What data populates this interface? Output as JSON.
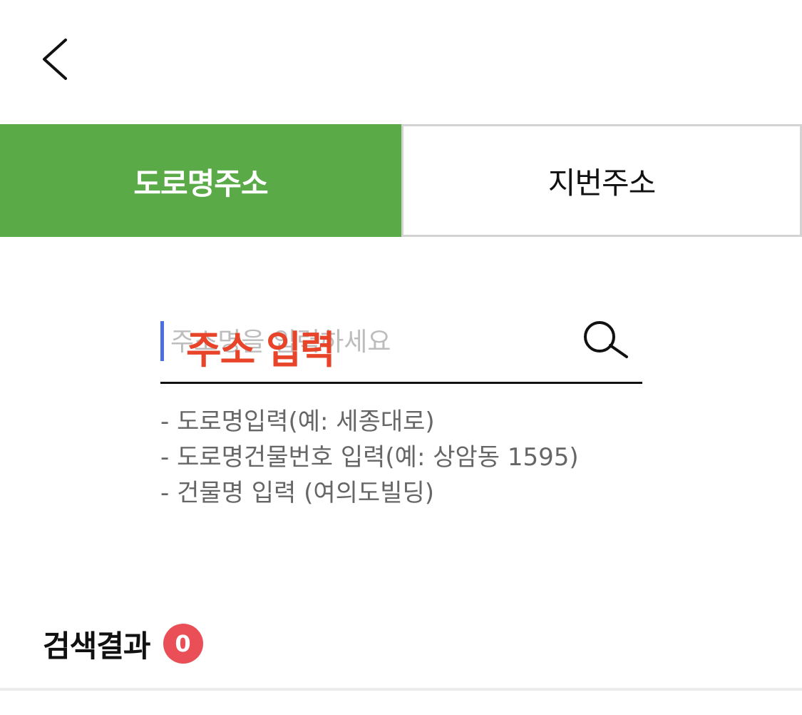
{
  "nav": {
    "back_icon": "chevron-left-icon"
  },
  "tabs": [
    {
      "label": "도로명주소",
      "active": true
    },
    {
      "label": "지번주소",
      "active": false
    }
  ],
  "search": {
    "placeholder": "주소명을 입력하세요",
    "value": "",
    "overlay_text": "주소 입력",
    "icon": "search-icon"
  },
  "hints": [
    "- 도로명입력(예: 세종대로)",
    "- 도로명건물번호 입력(예: 상암동 1595)",
    "- 건물명 입력 (여의도빌딩)"
  ],
  "results": {
    "title": "검색결과",
    "count": "0"
  },
  "colors": {
    "active_tab": "#5aaa47",
    "badge": "#ea4f57",
    "overlay_text": "#e8442a",
    "caret": "#4a6fe0"
  }
}
